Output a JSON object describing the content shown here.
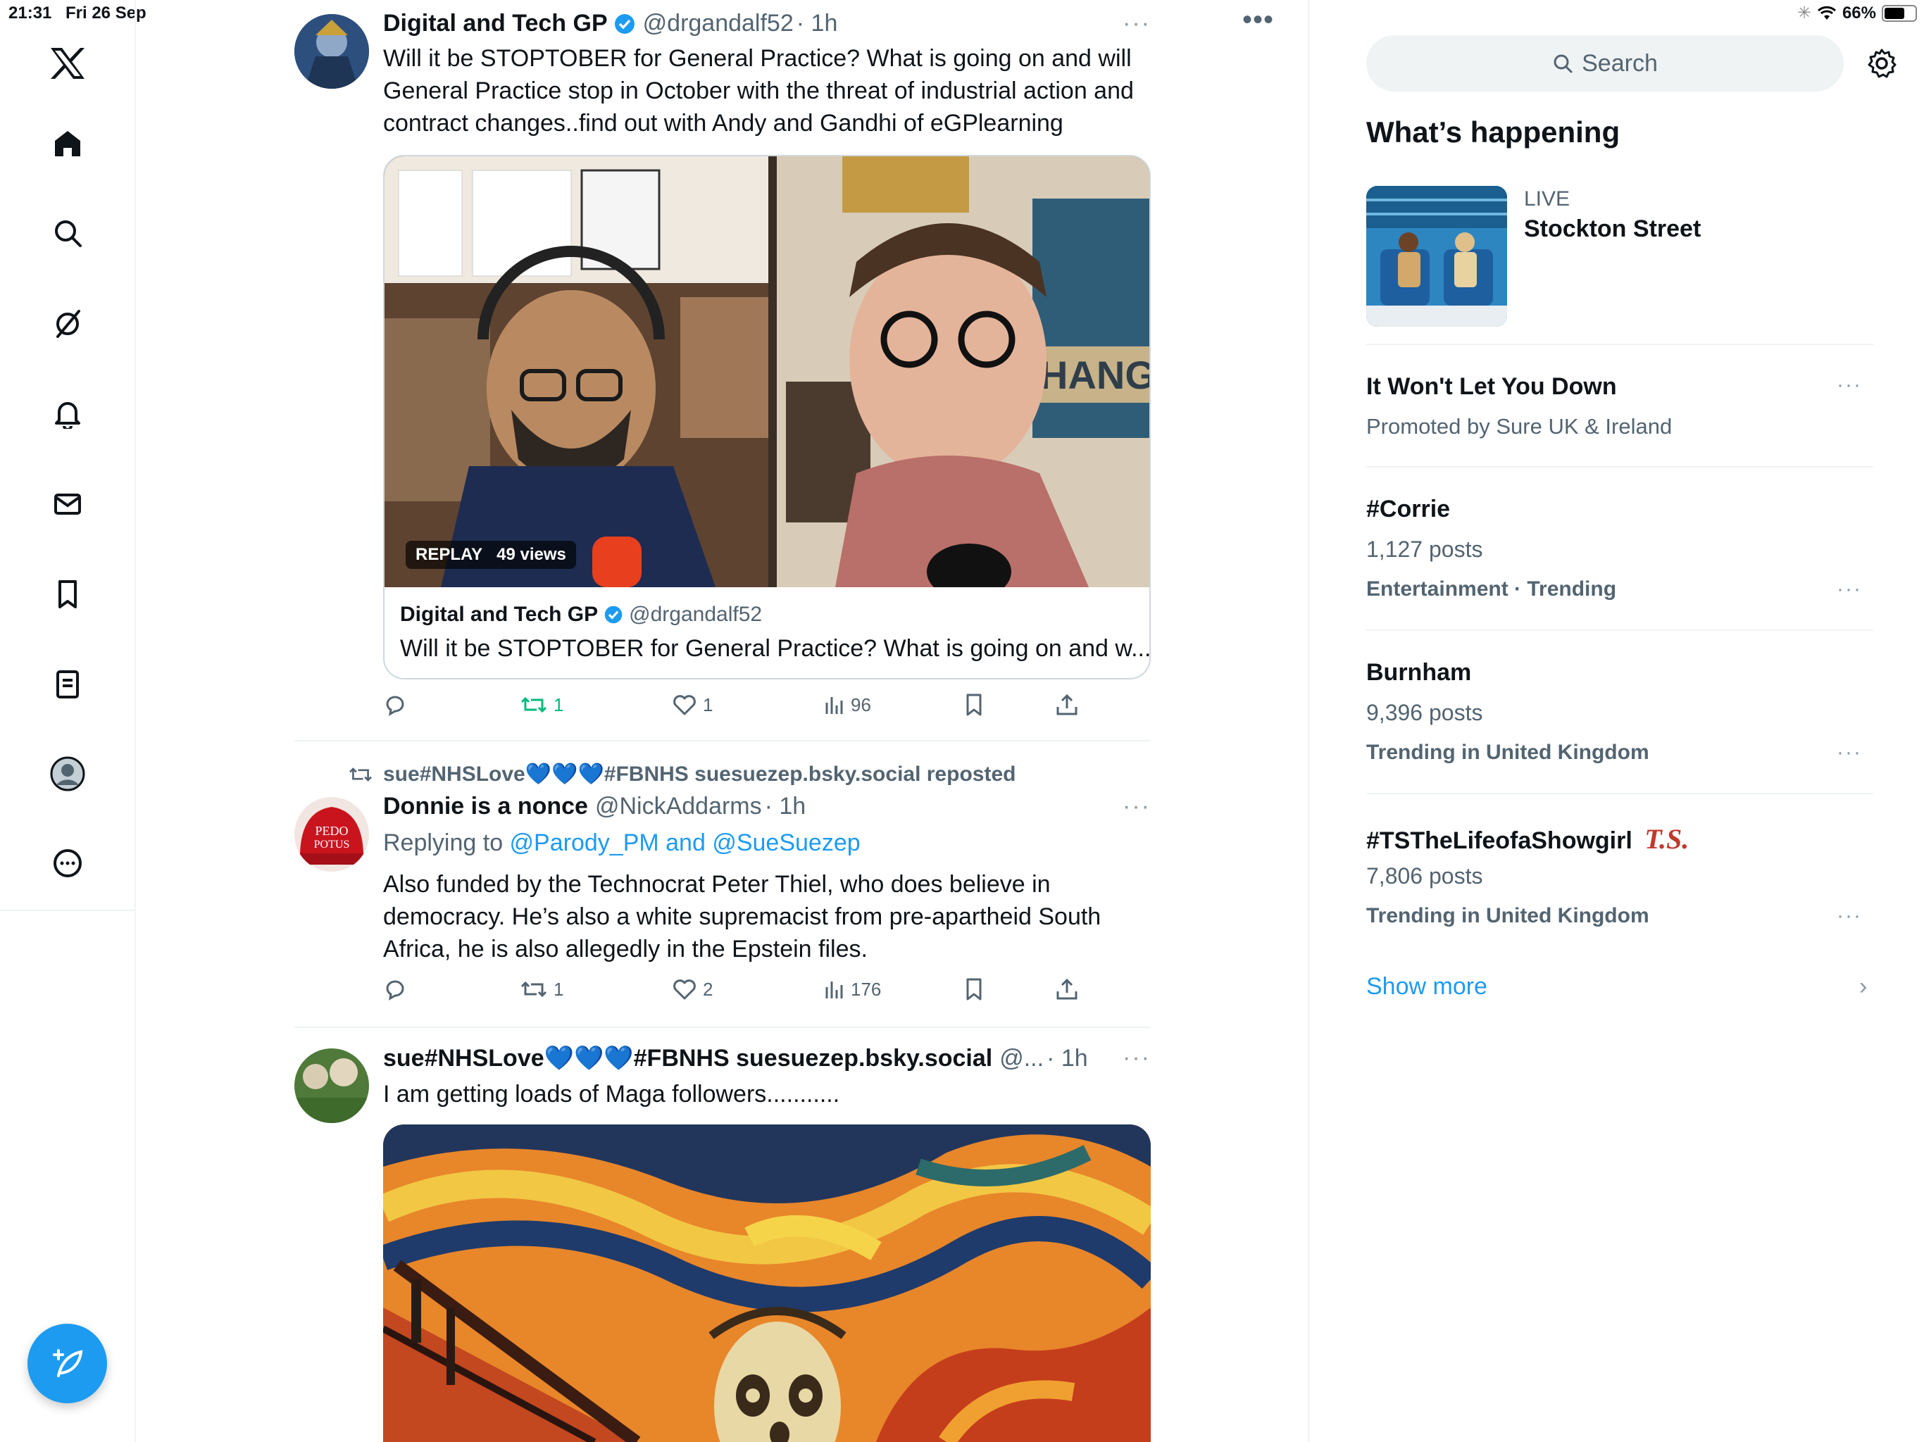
{
  "status_bar": {
    "time": "21:31",
    "date": "Fri 26 Sep",
    "battery": "66%",
    "battery_level": 0.66
  },
  "nav": {
    "items": [
      "home",
      "explore",
      "grok",
      "notifications",
      "messages",
      "bookmarks",
      "lists",
      "profile",
      "more"
    ]
  },
  "feed": {
    "tweets": [
      {
        "name": "Digital and Tech GP",
        "handle": "@drgandalf52",
        "time": "· 1h",
        "text": "Will it be STOPTOBER for General Practice? What is going on and will General Practice stop in October with the threat of industrial action and contract changes..find out with Andy and Gandhi of eGPlearning",
        "media": {
          "replay": "REPLAY",
          "views": "49 views",
          "card_name": "Digital and Tech GP",
          "card_handle": "@drgandalf52",
          "card_text": "Will it be STOPTOBER for General Practice? What is going on and w..."
        },
        "retweets": "1",
        "likes": "1",
        "views": "96"
      },
      {
        "repost_label": "sue#NHSLove💙💙💙#FBNHS suesuezep.bsky.social reposted",
        "name": "Donnie is a nonce",
        "handle": "@NickAddarms",
        "time": "· 1h",
        "replying_prefix": "Replying to ",
        "replying_to": "@Parody_PM and @SueSuezep",
        "text": "Also funded by the Technocrat Peter Thiel, who does believe in democracy. He’s also a white supremacist from pre-apartheid South Africa, he is also allegedly in the Epstein files.",
        "retweets": "1",
        "likes": "2",
        "views": "176"
      },
      {
        "name": "sue#NHSLove💙💙💙#FBNHS suesuezep.bsky.social",
        "handle": "@...",
        "time": "· 1h",
        "text": "I am getting loads of Maga followers..........."
      }
    ]
  },
  "sidebar": {
    "search_placeholder": "Search",
    "heading": "What’s happening",
    "live": {
      "label": "LIVE",
      "title": "Stockton Street"
    },
    "promoted": {
      "title": "It Won't Let You Down",
      "subtitle": "Promoted by Sure UK & Ireland"
    },
    "trends": [
      {
        "name": "#Corrie",
        "posts": "1,127 posts",
        "context": "Entertainment · Trending"
      },
      {
        "name": "Burnham",
        "posts": "9,396 posts",
        "context": "Trending in United Kingdom"
      },
      {
        "name": "#TSTheLifeofaShowgirl",
        "badge": "T.S.",
        "posts": "7,806 posts",
        "context": "Trending in United Kingdom"
      }
    ],
    "show_more": "Show more"
  }
}
